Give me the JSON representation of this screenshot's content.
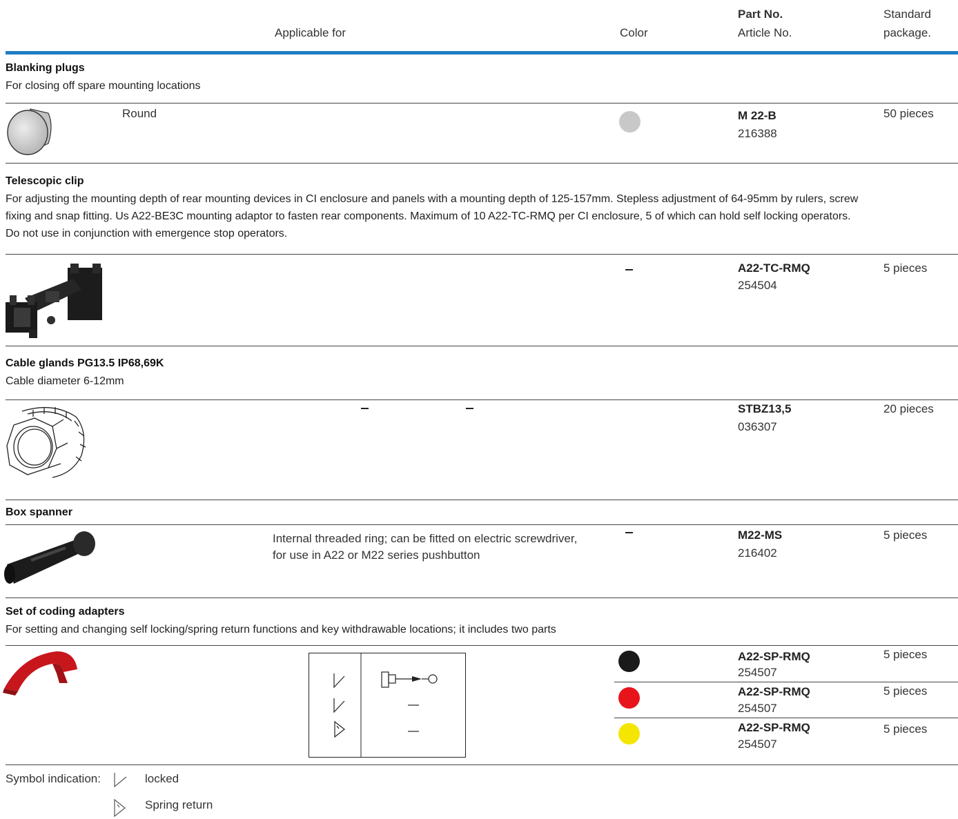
{
  "header": {
    "applicable": "Applicable for",
    "color": "Color",
    "partno": "Part No.",
    "articleno": "Article No.",
    "standard": "Standard",
    "package": "package."
  },
  "blanking": {
    "title": "Blanking plugs",
    "desc": "For closing off spare mounting locations",
    "applicable": "Round",
    "color_hex": "#c8c8c8",
    "partno": "M 22-B",
    "articleno": "216388",
    "package": "50 pieces"
  },
  "telescopic": {
    "title": "Telescopic clip",
    "desc_lines": [
      "For adjusting the mounting depth of rear mounting devices in CI enclosure and panels with a mounting depth of 125-157mm. Stepless adjustment of 64-95mm by rulers, screw",
      "fixing and snap fitting. Us A22-BE3C mounting adaptor to fasten rear components. Maximum of 10 A22-TC-RMQ per CI enclosure, 5 of which can hold self locking operators.",
      "Do not use in conjunction with emergence stop operators."
    ],
    "partno": "A22-TC-RMQ",
    "articleno": "254504",
    "package": "5 pieces"
  },
  "cableglands": {
    "title": "Cable glands PG13.5 IP68,69K",
    "desc": "Cable diameter 6-12mm",
    "partno": "STBZ13,5",
    "articleno": "036307",
    "package": "20 pieces"
  },
  "spanner": {
    "title": "Box spanner",
    "applicable_lines": [
      "Internal threaded ring; can be fitted on electric screwdriver,",
      "for use in A22 or M22 series pushbutton"
    ],
    "partno": "M22-MS",
    "articleno": "216402",
    "package": "5 pieces"
  },
  "coding": {
    "title": "Set of coding adapters",
    "desc": "For setting and changing self locking/spring return functions and key withdrawable locations; it includes two parts",
    "variants": [
      {
        "color_hex": "#1a1a1a",
        "partno": "A22-SP-RMQ",
        "articleno": "254507",
        "package": "5 pieces"
      },
      {
        "color_hex": "#e8141c",
        "partno": "A22-SP-RMQ",
        "articleno": "254507",
        "package": "5 pieces"
      },
      {
        "color_hex": "#f4e600",
        "partno": "A22-SP-RMQ",
        "articleno": "254507",
        "package": "5 pieces"
      }
    ]
  },
  "legend": {
    "label": "Symbol indication:",
    "locked": "locked",
    "spring": "Spring return"
  }
}
